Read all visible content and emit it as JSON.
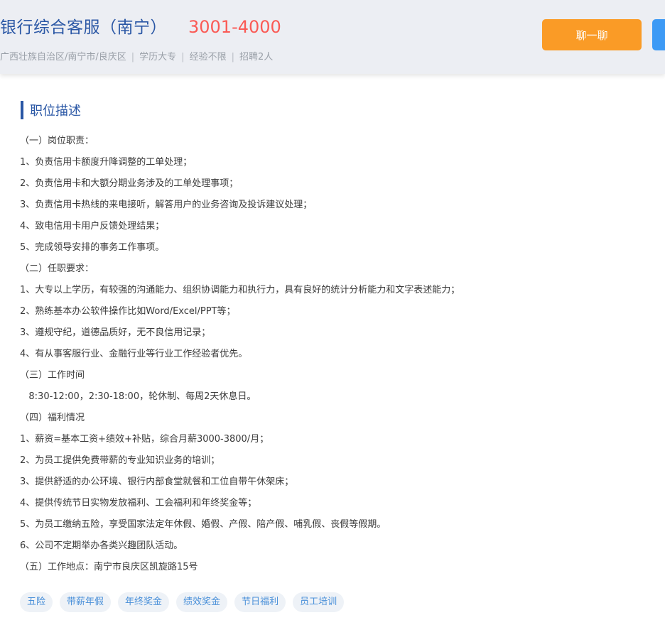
{
  "header": {
    "title": "银行综合客服（南宁）",
    "salary": "3001-4000",
    "meta": [
      "广西壮族自治区/南宁市/良庆区",
      "学历大专",
      "经验不限",
      "招聘2人"
    ],
    "meta_separator": "|",
    "chat_label": "聊一聊"
  },
  "section": {
    "title": "职位描述"
  },
  "description": [
    "（一）岗位职责：",
    "1、负责信用卡额度升降调整的工单处理；",
    "2、负责信用卡和大额分期业务涉及的工单处理事项；",
    "3、负责信用卡热线的来电接听，解答用户的业务咨询及投诉建议处理；",
    "4、致电信用卡用户反馈处理结果；",
    "5、完成领导安排的事务工作事项。",
    "（二）任职要求：",
    "1、大专以上学历，有较强的沟通能力、组织协调能力和执行力，具有良好的统计分析能力和文字表述能力；",
    "2、熟练基本办公软件操作比如Word/Excel/PPT等；",
    "3、遵规守纪，道德品质好，无不良信用记录；",
    "4、有从事客服行业、金融行业等行业工作经验者优先。",
    "（三）工作时间",
    "   8:30-12:00，2:30-18:00，轮休制、每周2天休息日。",
    "（四）福利情况",
    "1、薪资=基本工资+绩效+补贴，综合月薪3000-3800/月；",
    "2、为员工提供免费带薪的专业知识业务的培训；",
    "3、提供舒适的办公环境、银行内部食堂就餐和工位自带午休架床；",
    "4、提供传统节日实物发放福利、工会福利和年终奖金等；",
    "5、为员工缴纳五险，享受国家法定年休假、婚假、产假、陪产假、哺乳假、丧假等假期。",
    "6、公司不定期举办各类兴趣团队活动。",
    "（五）工作地点：南宁市良庆区凯旋路15号"
  ],
  "tags": [
    "五险",
    "带薪年假",
    "年终奖金",
    "绩效奖金",
    "节日福利",
    "员工培训"
  ],
  "colors": {
    "accent_blue": "#2a57a5",
    "salary_red": "#fa5a55",
    "chat_orange": "#fa9b26",
    "apply_blue": "#3d9af5"
  }
}
